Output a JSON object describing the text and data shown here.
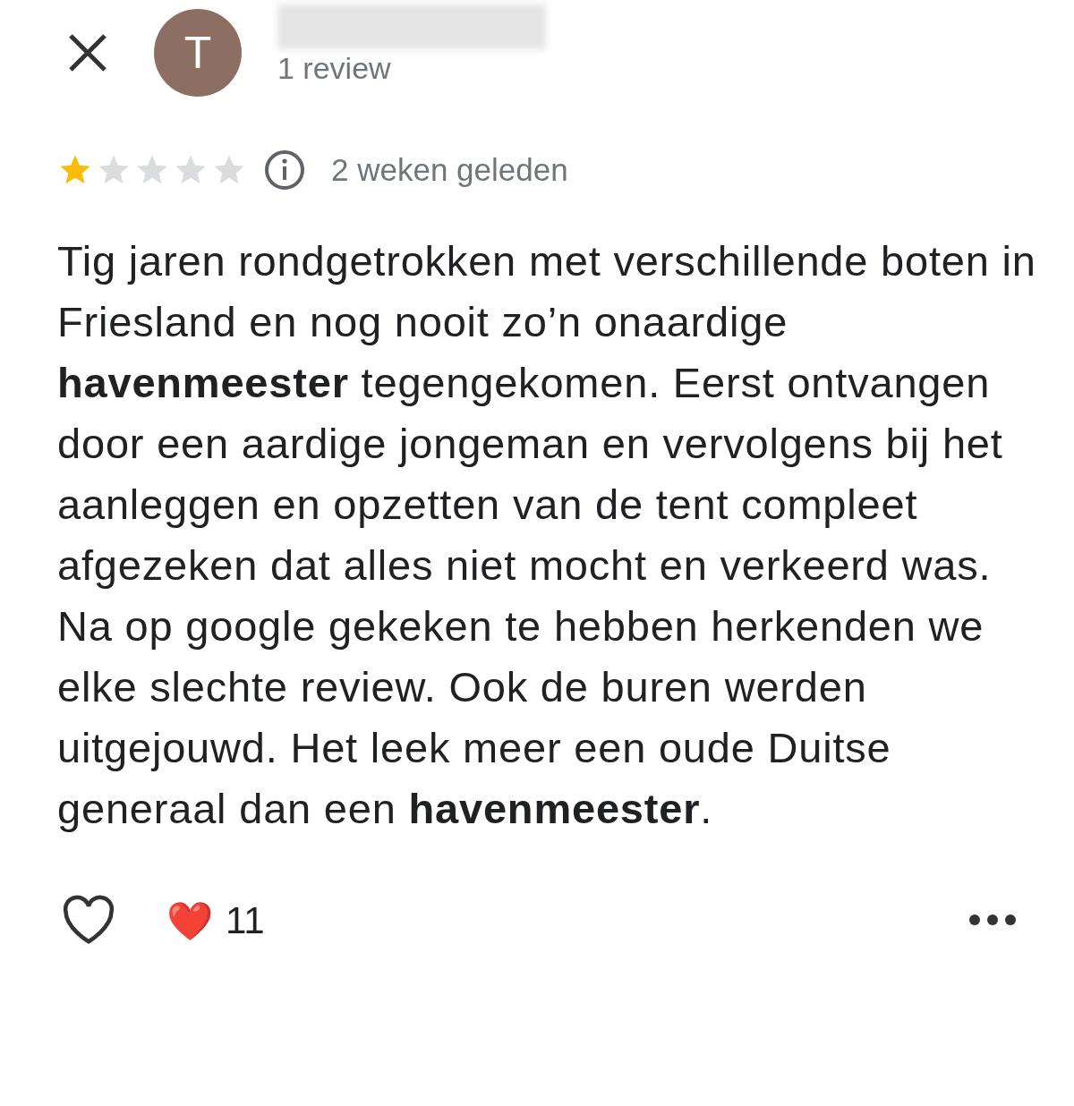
{
  "reviewer": {
    "initial": "T",
    "review_count": "1 review"
  },
  "review": {
    "stars": 1,
    "time": "2 weken geleden",
    "text": "Tig jaren rondgetrokken met verschillende boten in Friesland en nog nooit zo’n onaardige **havenmeester** tegengekomen. Eerst ontvangen door een aardige jongeman en vervolgens bij het aanleggen en opzetten van de tent compleet afgezeken dat alles niet mocht en verkeerd was. Na op google gekeken te hebben herkenden we elke slechte review. Ook de buren werden uitgejouwd. Het leek meer een oude Duitse generaal dan een **havenmeester**."
  },
  "footer": {
    "liked": false,
    "reaction_emoji": "❤️",
    "reaction_count": "11"
  }
}
